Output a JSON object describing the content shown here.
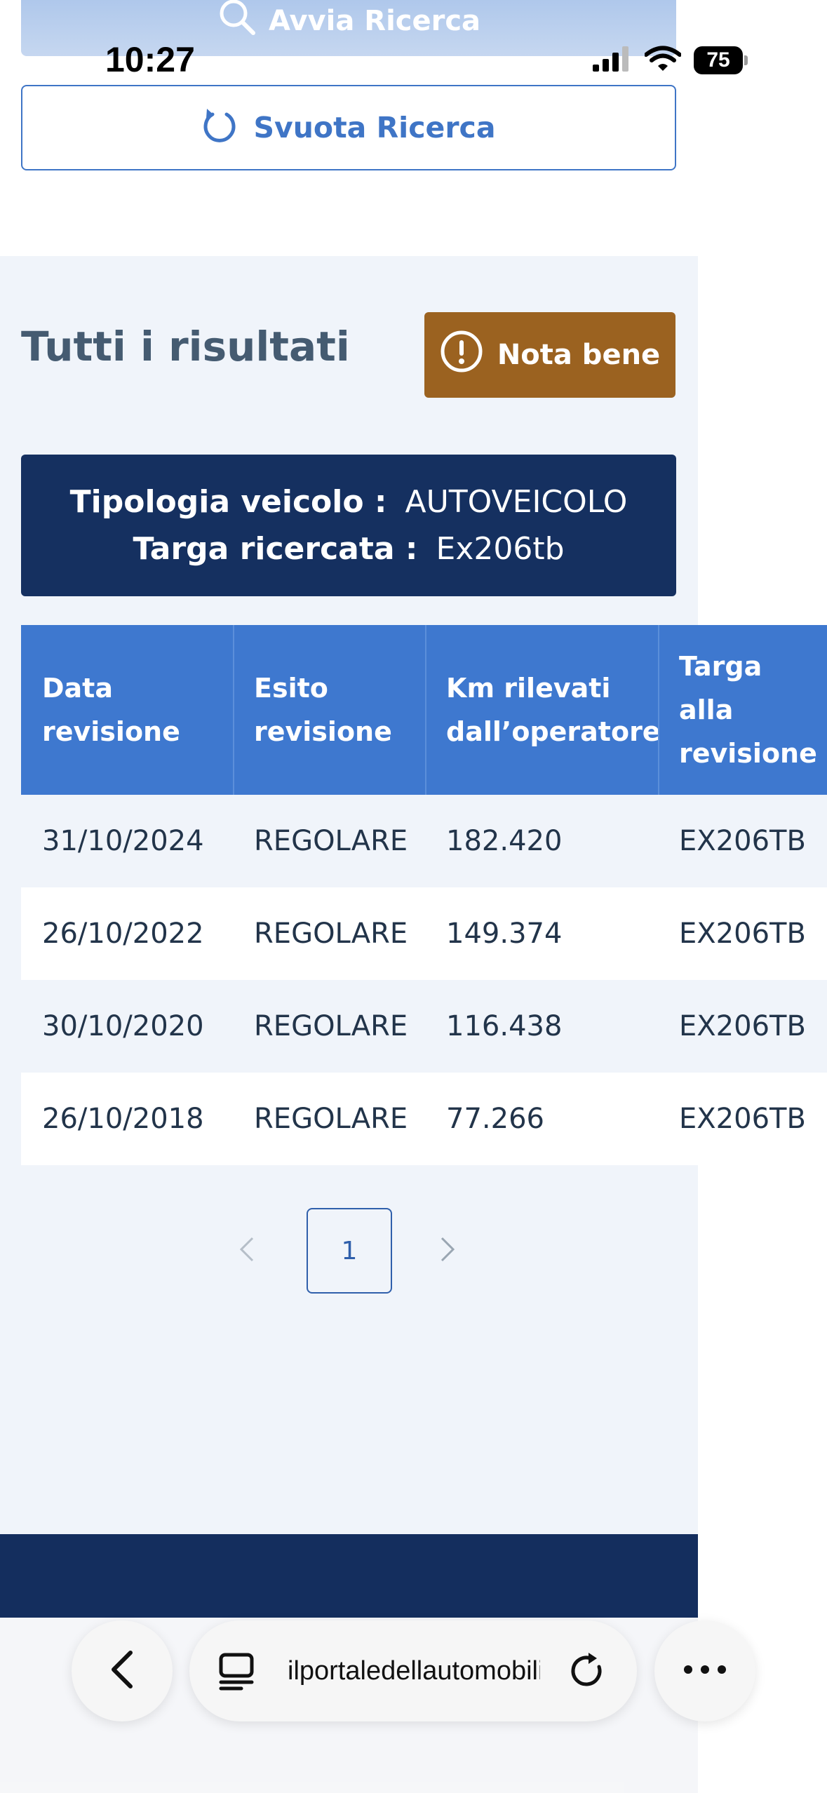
{
  "search": {
    "start_label": "Avvia Ricerca",
    "clear_label": "Svuota Ricerca"
  },
  "status_bar": {
    "time": "10:27",
    "battery": "75"
  },
  "results": {
    "title": "Tutti i risultati",
    "note_button": "Nota bene",
    "vehicle_type_label": "Tipologia veicolo :",
    "vehicle_type_value": "AUTOVEICOLO",
    "plate_label": "Targa ricercata :",
    "plate_value": "Ex206tb"
  },
  "table": {
    "headers": [
      [
        "Data",
        "revisione"
      ],
      [
        "Esito",
        "revisione"
      ],
      [
        "Km rilevati",
        "dall’operatore"
      ],
      [
        "Targa",
        "alla",
        "revisione"
      ]
    ],
    "rows": [
      [
        "31/10/2024",
        "REGOLARE",
        "182.420",
        "EX206TB"
      ],
      [
        "26/10/2022",
        "REGOLARE",
        "149.374",
        "EX206TB"
      ],
      [
        "30/10/2020",
        "REGOLARE",
        "116.438",
        "EX206TB"
      ],
      [
        "26/10/2018",
        "REGOLARE",
        "77.266",
        "EX206TB"
      ]
    ]
  },
  "pagination": {
    "prev_icon": "chevron-left-icon",
    "current_page": "1",
    "next_icon": "chevron-right-icon"
  },
  "browser": {
    "url": "ilportaledellautomobilista.it",
    "back_icon": "chevron-left-icon",
    "reader_icon": "reader-mode-icon",
    "reload_icon": "reload-icon",
    "more_icon": "more-icon"
  },
  "colors": {
    "primary": "#3e78cf",
    "dark_navy": "#153060",
    "note_brown": "#9b6220",
    "section_bg": "#f0f4fa"
  }
}
